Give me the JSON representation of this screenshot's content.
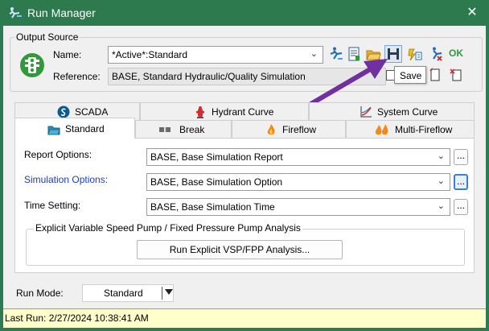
{
  "window": {
    "title": "Run Manager",
    "close_glyph": "✕"
  },
  "output_source": {
    "legend": "Output Source",
    "name_label": "Name:",
    "name_value": "*Active*:Standard",
    "reference_label": "Reference:",
    "reference_value": "BASE, Standard Hydraulic/Quality Simulation",
    "toolbar_icons": [
      "run-icon",
      "report-icon",
      "open-folder-icon",
      "save-icon",
      "batch-icon",
      "compare-icon",
      "ok-icon"
    ],
    "ok_label": "OK",
    "tooltip": "Save"
  },
  "tabs_row1": [
    {
      "label": "SCADA",
      "icon": "scada-icon"
    },
    {
      "label": "Hydrant Curve",
      "icon": "hydrant-icon"
    },
    {
      "label": "System Curve",
      "icon": "system-curve-icon"
    }
  ],
  "tabs_row2": [
    {
      "label": "Standard",
      "icon": "folder-icon",
      "active": true
    },
    {
      "label": "Break",
      "icon": "pipe-break-icon"
    },
    {
      "label": "Fireflow",
      "icon": "flame-icon"
    },
    {
      "label": "Multi-Fireflow",
      "icon": "multi-flame-icon"
    }
  ],
  "options": {
    "report_label": "Report Options:",
    "report_value": "BASE, Base Simulation Report",
    "simulation_label": "Simulation Options:",
    "simulation_value": "BASE, Base Simulation Option",
    "time_label": "Time Setting:",
    "time_value": "BASE, Base Simulation Time",
    "ellipsis": "..."
  },
  "vsp": {
    "legend": "Explicit Variable Speed Pump / Fixed Pressure Pump Analysis",
    "button": "Run Explicit VSP/FPP Analysis..."
  },
  "run_mode": {
    "label": "Run Mode:",
    "value": "Standard"
  },
  "status": {
    "last_run": "Last Run: 2/27/2024 10:38:41 AM"
  },
  "colors": {
    "title_bar": "#2d7a4f",
    "status_bar": "#ffffcc",
    "annotation_arrow": "#7030a0",
    "link_label": "#1a3cc8"
  }
}
